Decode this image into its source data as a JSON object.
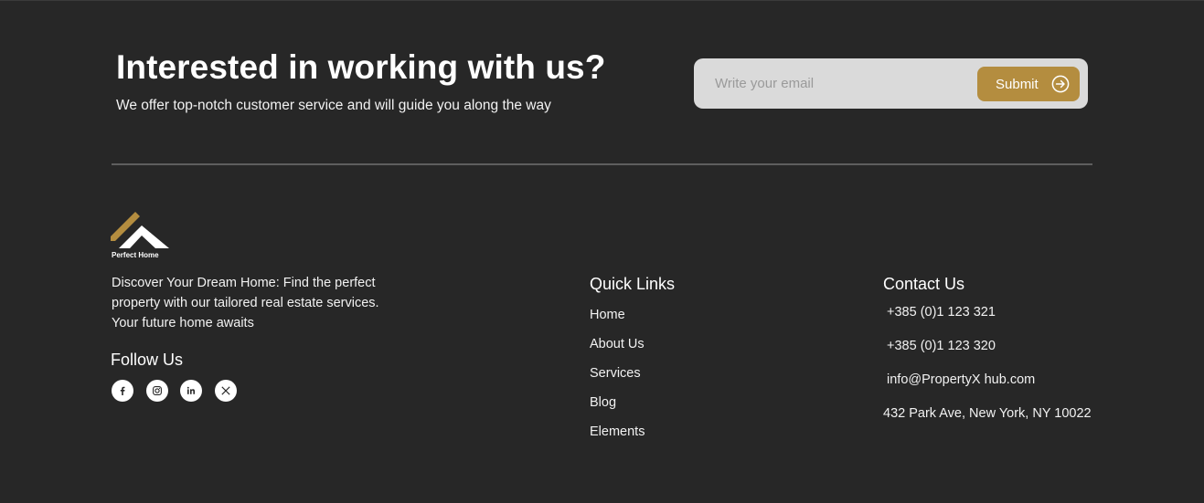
{
  "cta": {
    "title": "Interested in working with us?",
    "subtitle": "We offer top-notch customer service and will guide you along the way"
  },
  "newsletter": {
    "placeholder": "Write your email",
    "submit_label": "Submit",
    "submit_icon": "arrow-right-circle-icon"
  },
  "brand": {
    "name": "Perfect Home",
    "logo_icon": "house-roof-logo",
    "description": "Discover Your Dream Home: Find the perfect property with our tailored real estate services. Your future home awaits"
  },
  "follow": {
    "title": "Follow Us",
    "networks": [
      "facebook-icon",
      "instagram-icon",
      "linkedin-icon",
      "x-icon"
    ]
  },
  "quick_links": {
    "title": "Quick Links",
    "items": [
      "Home",
      "About Us",
      "Services",
      "Blog",
      "Elements"
    ]
  },
  "contact": {
    "title": "Contact Us",
    "phone1": "+385 (0)1 123 321",
    "phone2": "+385 (0)1 123 320",
    "email": "info@PropertyX hub.com",
    "address": "432 Park Ave, New York, NY 10022"
  },
  "colors": {
    "background": "#272727",
    "accent": "#b48d3f",
    "input_bg": "#dadada",
    "divider": "#5e5e5e"
  }
}
